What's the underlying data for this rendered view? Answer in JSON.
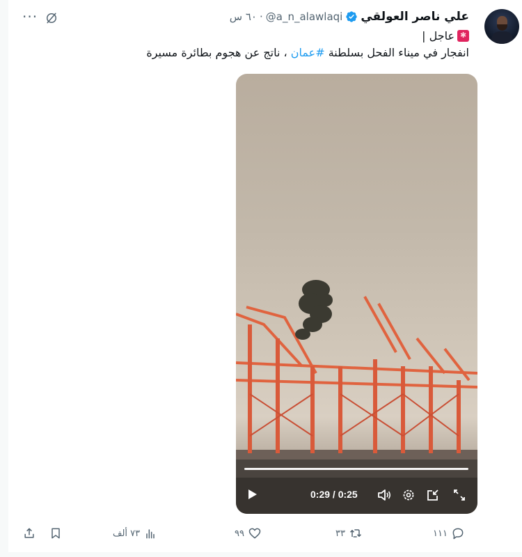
{
  "tweet": {
    "author_name": "علي ناصر العولقي",
    "handle": "@a_n_alawlaqi",
    "separator": "·",
    "time": "٦٠ س",
    "line1": "عاجل |",
    "line2_before": "انفجار في ميناء الفحل بسلطنة ",
    "hashtag": "#عمان",
    "line2_after": " ، ناتج عن هجوم بطائرة مسيرة"
  },
  "video": {
    "timecode": "0:29 / 0:25",
    "progress": 1.0
  },
  "actions": {
    "replies": "١١١",
    "retweets": "٣٣",
    "likes": "٩٩",
    "views": "٧٣ ألف"
  },
  "colors": {
    "accent": "#1d9bf0",
    "muted": "#536471",
    "text": "#0f1419",
    "siren": "#e0245e"
  },
  "icons": [
    "more-icon",
    "grok-icon",
    "verified-icon",
    "siren-icon",
    "play-icon",
    "volume-icon",
    "settings-icon",
    "pip-icon",
    "fullscreen-icon",
    "reply-icon",
    "retweet-icon",
    "like-icon",
    "views-icon",
    "bookmark-icon",
    "share-icon"
  ]
}
